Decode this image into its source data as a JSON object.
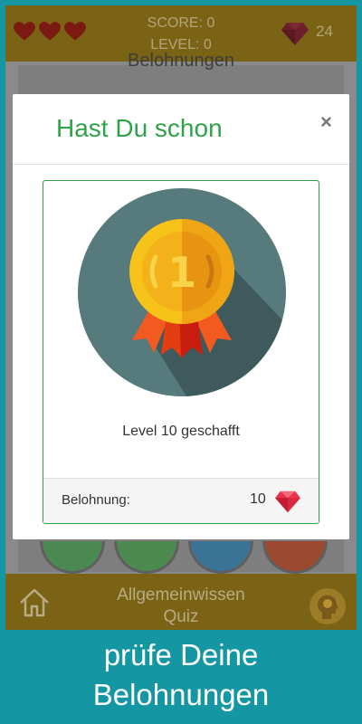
{
  "topbar": {
    "hearts": [
      "heart-icon",
      "heart-icon",
      "heart-icon"
    ],
    "score_text": "SCORE: 0",
    "level_text": "LEVEL: 0",
    "gems": "24"
  },
  "background": {
    "title": "Belohnungen"
  },
  "modal": {
    "title": "Hast Du schon",
    "close": "×",
    "achievement": "Level 10 geschafft",
    "reward_label": "Belohnung:",
    "reward_value": "10",
    "medal_number": "1"
  },
  "bottombar": {
    "title_line1": "Allgemeinwissen",
    "title_line2": "Quiz"
  },
  "caption": {
    "line1": "prüfe Deine",
    "line2": "Belohnungen"
  },
  "colors": {
    "accent_green": "#2fa34a",
    "bar_brown": "#7a6314",
    "caption_bg": "#1496a3"
  }
}
